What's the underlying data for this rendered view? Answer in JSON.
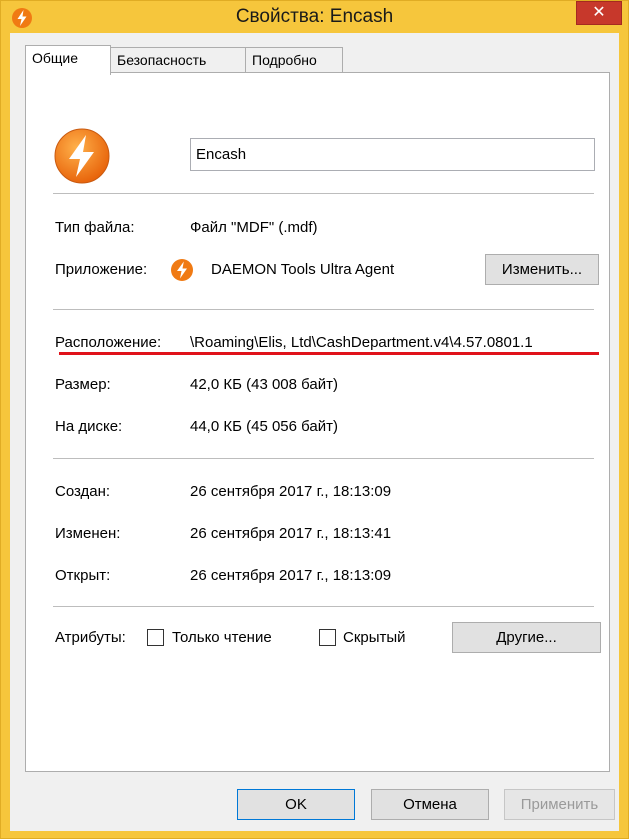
{
  "window": {
    "title": "Свойства: Encash",
    "close_glyph": "✕",
    "accent_title": "#f6c63c",
    "close_color": "#c7382b"
  },
  "tabs": [
    {
      "label": "Общие",
      "active": true
    },
    {
      "label": "Безопасность",
      "active": false
    },
    {
      "label": "Подробно",
      "active": false
    }
  ],
  "general": {
    "file_name": "Encash",
    "app_icon": "daemon-tools-icon",
    "file_type_label": "Тип файла:",
    "file_type_value": "Файл \"MDF\" (.mdf)",
    "app_label": "Приложение:",
    "app_value": "DAEMON Tools Ultra Agent",
    "change_button": "Изменить...",
    "location_label": "Расположение:",
    "location_value": "\\Roaming\\Elis, Ltd\\CashDepartment.v4\\4.57.0801.1",
    "size_label": "Размер:",
    "size_value": "42,0 КБ (43 008 байт)",
    "disk_label": "На диске:",
    "disk_value": "44,0 КБ (45 056 байт)",
    "created_label": "Создан:",
    "created_value": "26 сентября 2017 г., 18:13:09",
    "modified_label": "Изменен:",
    "modified_value": "26 сентября 2017 г., 18:13:41",
    "opened_label": "Открыт:",
    "opened_value": "26 сентября 2017 г., 18:13:09",
    "attributes_label": "Атрибуты:",
    "readonly_label": "Только чтение",
    "hidden_label": "Скрытый",
    "other_button": "Другие..."
  },
  "footer": {
    "ok": "OK",
    "cancel": "Отмена",
    "apply": "Применить"
  },
  "annotation_color": "#e0121a"
}
